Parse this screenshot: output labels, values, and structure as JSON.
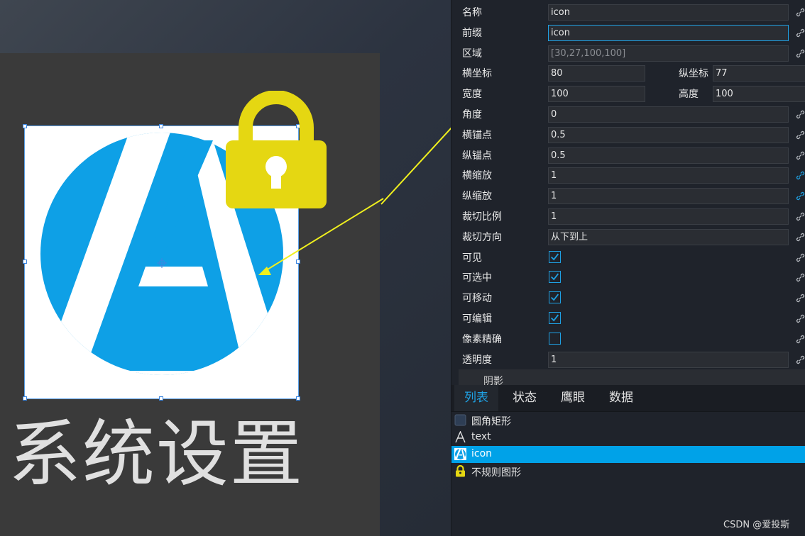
{
  "canvas": {
    "overlay_text": "系统设置",
    "icon_colors": {
      "circle": "#0ea0e6",
      "background": "#ffffff",
      "lock": "#e5d712",
      "annotation_arrow": "#f0f01e"
    }
  },
  "properties": [
    {
      "label": "名称",
      "value": "icon",
      "type": "text"
    },
    {
      "label": "前缀",
      "value": "icon",
      "type": "text",
      "focused": true
    },
    {
      "label": "区域",
      "value": "[30,27,100,100]",
      "type": "text",
      "disabled": true
    },
    {
      "label": "横坐标",
      "value": "80",
      "type": "pair",
      "sub_label": "纵坐标",
      "sub_value": "77"
    },
    {
      "label": "宽度",
      "value": "100",
      "type": "pair",
      "sub_label": "高度",
      "sub_value": "100"
    },
    {
      "label": "角度",
      "value": "0",
      "type": "text"
    },
    {
      "label": "横锚点",
      "value": "0.5",
      "type": "text"
    },
    {
      "label": "纵锚点",
      "value": "0.5",
      "type": "text"
    },
    {
      "label": "横缩放",
      "value": "1",
      "type": "text",
      "link_active": true
    },
    {
      "label": "纵缩放",
      "value": "1",
      "type": "text",
      "link_active": true
    },
    {
      "label": "裁切比例",
      "value": "1",
      "type": "text"
    },
    {
      "label": "裁切方向",
      "value": "从下到上",
      "type": "select"
    },
    {
      "label": "可见",
      "checked": true,
      "type": "checkbox"
    },
    {
      "label": "可选中",
      "checked": true,
      "type": "checkbox"
    },
    {
      "label": "可移动",
      "checked": true,
      "type": "checkbox"
    },
    {
      "label": "可编辑",
      "checked": true,
      "type": "checkbox"
    },
    {
      "label": "像素精确",
      "checked": false,
      "type": "checkbox"
    },
    {
      "label": "透明度",
      "value": "1",
      "type": "text"
    }
  ],
  "shadow_group": {
    "label": "阴影"
  },
  "tabs": [
    "列表",
    "状态",
    "鹰眼",
    "数据"
  ],
  "active_tab": 0,
  "layers": [
    {
      "label": "圆角矩形",
      "icon": "rounded-rect-icon"
    },
    {
      "label": "text",
      "icon": "text-icon"
    },
    {
      "label": "icon",
      "icon": "app-logo-icon",
      "selected": true
    },
    {
      "label": "不规则图形",
      "icon": "lock-icon"
    }
  ],
  "watermark": "CSDN @爱投斯"
}
